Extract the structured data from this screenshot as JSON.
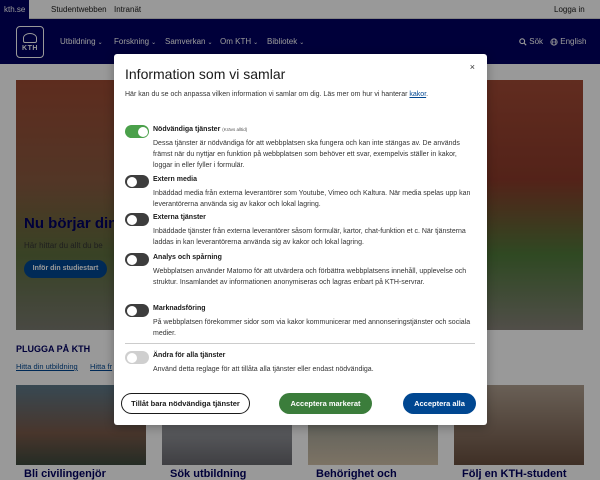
{
  "topbar": {
    "links": [
      "kth.se",
      "Studentwebben",
      "Intranät"
    ],
    "login": "Logga in"
  },
  "navbar": {
    "logo_text": "KTH",
    "items": [
      "Utbildning",
      "Forskning",
      "Samverkan",
      "Om KTH",
      "Bibliotek"
    ],
    "search": "Sök",
    "language": "English"
  },
  "hero": {
    "title": "Nu börjar din t",
    "subtitle": "Här hittar du allt du be",
    "button": "Inför din studiestart"
  },
  "section": {
    "title": "PLUGGA PÅ KTH",
    "links": [
      "Hitta din utbildning",
      "Hitta fr"
    ]
  },
  "cards": {
    "titles": [
      "Bli civilingenjör",
      "Sök utbildning",
      "Behörighet och",
      "Följ en KTH-student"
    ]
  },
  "modal": {
    "title": "Information som vi samlar",
    "close": "×",
    "intro_text": "Här kan du se och anpassa vilken information vi samlar om dig. Läs mer om hur vi hanterar ",
    "intro_link": "kakor",
    "intro_end": ".",
    "options": [
      {
        "title": "Nödvändiga tjänster",
        "required_note": "(Krävs alltid)",
        "description": "Dessa tjänster är nödvändiga för att webbplatsen ska fungera och kan inte stängas av. De används främst när du nyttjar en funktion på webbplatsen som behöver ett svar, exempelvis ställer in kakor, loggar in eller fyller i formulär.",
        "state": "on"
      },
      {
        "title": "Extern media",
        "required_note": "",
        "description": "Inbäddad media från externa leverantörer som Youtube, Vimeo och Kaltura. När media spelas upp kan leverantörerna använda sig av kakor och lokal lagring.",
        "state": "off"
      },
      {
        "title": "Externa tjänster",
        "required_note": "",
        "description": "Inbäddade tjänster från externa leverantörer såsom formulär, kartor, chat-funktion et c. När tjänsterna laddas in kan leverantörerna använda sig av kakor och lokal lagring.",
        "state": "off"
      },
      {
        "title": "Analys och spårning",
        "required_note": "",
        "description": "Webbplatsen använder Matomo för att utvärdera och förbättra webbplatsens innehåll, upplevelse och struktur. Insamlandet av informationen anonymiseras och lagras enbart på KTH-servrar.",
        "state": "off"
      },
      {
        "title": "Marknadsföring",
        "required_note": "",
        "description": "På webbplatsen förekommer sidor som via kakor kommunicerar med annonseringstjänster och sociala medier.",
        "state": "off"
      },
      {
        "title": "Ändra för alla tjänster",
        "required_note": "",
        "description": "Använd detta reglage för att tillåta alla tjänster eller endast nödvändiga.",
        "state": "neutral"
      }
    ],
    "buttons": {
      "necessary_only": "Tillåt bara nödvändiga tjänster",
      "accept_selected": "Acceptera markerat",
      "accept_all": "Acceptera alla"
    }
  },
  "colors": {
    "brand_navy": "#000061",
    "link_blue": "#004791",
    "toggle_on": "#4aa04a",
    "toggle_off": "#3d3d3d",
    "accept_selected": "#3b7d3b",
    "accept_all": "#004791"
  },
  "icons": {
    "close": "close-icon",
    "search": "search-icon",
    "language": "globe-icon",
    "nav_chevron": "chevron-down-icon"
  }
}
